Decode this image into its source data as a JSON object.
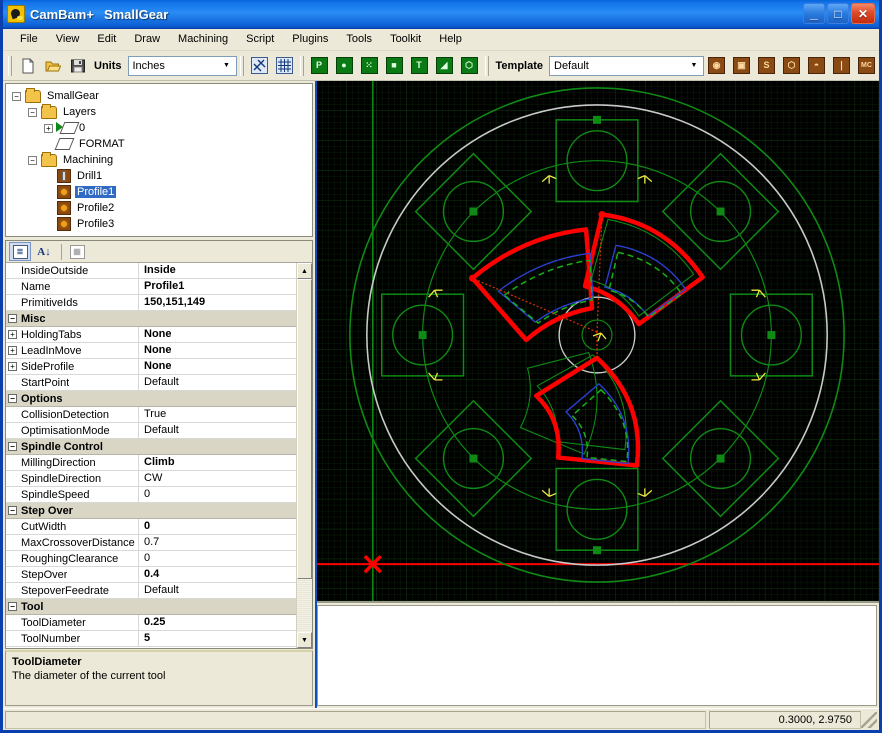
{
  "window": {
    "app_name": "CamBam+",
    "document_name": "SmallGear",
    "icon": "cambam-logo-icon",
    "buttons": {
      "minimize": "_",
      "maximize": "□",
      "close": "✕"
    }
  },
  "menubar": {
    "items": [
      {
        "label": "File"
      },
      {
        "label": "View"
      },
      {
        "label": "Edit"
      },
      {
        "label": "Draw"
      },
      {
        "label": "Machining"
      },
      {
        "label": "Script"
      },
      {
        "label": "Plugins"
      },
      {
        "label": "Tools"
      },
      {
        "label": "Toolkit"
      },
      {
        "label": "Help"
      }
    ]
  },
  "toolbar": {
    "file_buttons": [
      {
        "name": "new-file-button",
        "glyph": "□"
      },
      {
        "name": "open-file-button",
        "glyph": "▱"
      },
      {
        "name": "save-file-button",
        "glyph": "■"
      }
    ],
    "units_label": "Units",
    "units_value": "Inches",
    "snap_buttons": [
      {
        "name": "snap-toggle-button",
        "glyph": "✕"
      },
      {
        "name": "grid-toggle-button",
        "glyph": "▒"
      }
    ],
    "draw_buttons": [
      {
        "name": "draw-polyline-button",
        "glyph": "P"
      },
      {
        "name": "draw-circle-button",
        "glyph": "●"
      },
      {
        "name": "draw-points-button",
        "glyph": "⁙"
      },
      {
        "name": "draw-rectangle-button",
        "glyph": "■"
      },
      {
        "name": "draw-text-button",
        "glyph": "T"
      },
      {
        "name": "draw-region-button",
        "glyph": "◢"
      },
      {
        "name": "draw-surface-button",
        "glyph": "⬡"
      }
    ],
    "template_label": "Template",
    "template_value": "Default",
    "machining_buttons": [
      {
        "name": "profile-mop-button",
        "glyph": "◉"
      },
      {
        "name": "pocket-mop-button",
        "glyph": "▣"
      },
      {
        "name": "engrave-mop-button",
        "glyph": "S"
      },
      {
        "name": "3d-surface-mop-button",
        "glyph": "⬡"
      },
      {
        "name": "drill-mop-button",
        "glyph": "◓"
      },
      {
        "name": "tool-library-button",
        "glyph": "❘"
      },
      {
        "name": "post-process-button",
        "glyph": "MC"
      }
    ]
  },
  "tree": {
    "nodes": [
      {
        "label": "SmallGear",
        "depth": 0,
        "icon": "folder-icon",
        "expander": "−",
        "selected": false
      },
      {
        "label": "Layers",
        "depth": 1,
        "icon": "folder-icon",
        "expander": "−",
        "selected": false
      },
      {
        "label": "0",
        "depth": 2,
        "icon": "layer-active-icon",
        "expander": "+",
        "selected": false
      },
      {
        "label": "FORMAT",
        "depth": 2,
        "icon": "layer-icon",
        "expander": "",
        "selected": false
      },
      {
        "label": "Machining",
        "depth": 1,
        "icon": "folder-icon",
        "expander": "−",
        "selected": false
      },
      {
        "label": "Drill1",
        "depth": 2,
        "icon": "drill-mop-icon",
        "expander": "",
        "selected": false
      },
      {
        "label": "Profile1",
        "depth": 2,
        "icon": "profile-mop-icon",
        "expander": "",
        "selected": true
      },
      {
        "label": "Profile2",
        "depth": 2,
        "icon": "profile-mop-icon",
        "expander": "",
        "selected": false
      },
      {
        "label": "Profile3",
        "depth": 2,
        "icon": "profile-mop-icon",
        "expander": "",
        "selected": false
      }
    ]
  },
  "property_grid": {
    "toolbar": {
      "categorized_button": "categorized-view-icon",
      "alphabetical_button": "alphabetical-sort-icon",
      "property_pages_button": "property-pages-icon"
    },
    "rows": [
      {
        "kind": "prop",
        "name": "InsideOutside",
        "value": "Inside",
        "bold": true,
        "expandable": false
      },
      {
        "kind": "prop",
        "name": "Name",
        "value": "Profile1",
        "bold": true,
        "expandable": false
      },
      {
        "kind": "prop",
        "name": "PrimitiveIds",
        "value": "150,151,149",
        "bold": true,
        "expandable": false
      },
      {
        "kind": "cat",
        "name": "Misc",
        "value": "",
        "bold": false,
        "expandable": true
      },
      {
        "kind": "prop",
        "name": "HoldingTabs",
        "value": "None",
        "bold": true,
        "expandable": true
      },
      {
        "kind": "prop",
        "name": "LeadInMove",
        "value": "None",
        "bold": true,
        "expandable": true
      },
      {
        "kind": "prop",
        "name": "SideProfile",
        "value": "None",
        "bold": true,
        "expandable": true
      },
      {
        "kind": "prop",
        "name": "StartPoint",
        "value": "Default",
        "bold": false,
        "expandable": false
      },
      {
        "kind": "cat",
        "name": "Options",
        "value": "",
        "bold": false,
        "expandable": true
      },
      {
        "kind": "prop",
        "name": "CollisionDetection",
        "value": "True",
        "bold": false,
        "expandable": false
      },
      {
        "kind": "prop",
        "name": "OptimisationMode",
        "value": "Default",
        "bold": false,
        "expandable": false
      },
      {
        "kind": "cat",
        "name": "Spindle Control",
        "value": "",
        "bold": false,
        "expandable": true
      },
      {
        "kind": "prop",
        "name": "MillingDirection",
        "value": "Climb",
        "bold": true,
        "expandable": false
      },
      {
        "kind": "prop",
        "name": "SpindleDirection",
        "value": "CW",
        "bold": false,
        "expandable": false
      },
      {
        "kind": "prop",
        "name": "SpindleSpeed",
        "value": "0",
        "bold": false,
        "expandable": false
      },
      {
        "kind": "cat",
        "name": "Step Over",
        "value": "",
        "bold": false,
        "expandable": true
      },
      {
        "kind": "prop",
        "name": "CutWidth",
        "value": "0",
        "bold": true,
        "expandable": false
      },
      {
        "kind": "prop",
        "name": "MaxCrossoverDistance",
        "value": "0.7",
        "bold": false,
        "expandable": false
      },
      {
        "kind": "prop",
        "name": "RoughingClearance",
        "value": "0",
        "bold": false,
        "expandable": false
      },
      {
        "kind": "prop",
        "name": "StepOver",
        "value": "0.4",
        "bold": true,
        "expandable": false
      },
      {
        "kind": "prop",
        "name": "StepoverFeedrate",
        "value": "Default",
        "bold": false,
        "expandable": false
      },
      {
        "kind": "cat",
        "name": "Tool",
        "value": "",
        "bold": false,
        "expandable": true
      },
      {
        "kind": "prop",
        "name": "ToolDiameter",
        "value": "0.25",
        "bold": true,
        "expandable": false
      },
      {
        "kind": "prop",
        "name": "ToolNumber",
        "value": "5",
        "bold": true,
        "expandable": false
      }
    ]
  },
  "description": {
    "title": "ToolDiameter",
    "text": "The diameter of the current tool"
  },
  "statusbar": {
    "message": "",
    "coordinates": "0.3000, 2.9750"
  },
  "colors": {
    "canvas_background": "#000000",
    "grid": "#0d2a0d",
    "geometry_green": "#0f8a14",
    "toolpath_red": "#ff0000",
    "toolpath_blue": "#2b3fd0",
    "toolpath_green_dash": "#18b018",
    "rapid_orange": "#d04000",
    "stock_white": "#c8c8c8",
    "axis_red": "#ff0000",
    "axis_green": "#0f8a14",
    "marker_yellow": "#e8e840",
    "selection_blue": "#316ac5"
  },
  "drawing": {
    "name": "small-gear-cad-view",
    "origin_marker": "origin-x-marker",
    "description": "Gear part with circular stock boundary, green geometry outlines, three red profile toolpaths and orange rapid moves"
  }
}
